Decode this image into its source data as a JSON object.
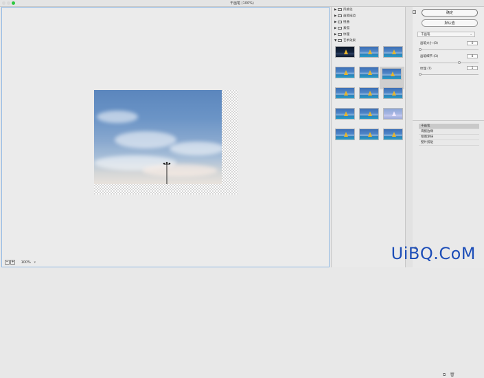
{
  "window": {
    "title": "干画笔 (100%)",
    "traffic_colors": [
      "#d9d9d9",
      "#d9d9d9",
      "#2cc840"
    ]
  },
  "preview": {
    "zoom_out_label": "−",
    "zoom_in_label": "+",
    "zoom_value": "100%",
    "zoom_dropdown_icon": "chevron-down-icon"
  },
  "gallery": {
    "folders": [
      {
        "label": "风格化",
        "expanded": false
      },
      {
        "label": "画笔描边",
        "expanded": false
      },
      {
        "label": "扭曲",
        "expanded": false
      },
      {
        "label": "素描",
        "expanded": false
      },
      {
        "label": "纹理",
        "expanded": false
      },
      {
        "label": "艺术效果",
        "expanded": true
      }
    ],
    "thumb_rows": 5,
    "thumb_cols": 3,
    "selected_thumb": 5
  },
  "settings": {
    "ok_label": "确定",
    "default_label": "默认值",
    "collapse_icon": "collapse-icon",
    "filter_select": "干画笔",
    "params": [
      {
        "label": "画笔大小 (B)",
        "value": "0",
        "fraction": 0.0
      },
      {
        "label": "画笔细节 (D)",
        "value": "8",
        "fraction": 0.8
      },
      {
        "label": "纹理 (T)",
        "value": "1",
        "fraction": 0.0
      }
    ]
  },
  "layers": {
    "items": [
      "干画笔",
      "海报边缘",
      "绘图涂抹",
      "壁片剪贴"
    ],
    "active": 0,
    "new_layer_icon": "new-layer-icon",
    "delete_icon": "trash-icon"
  },
  "watermark": "UiBQ.CoM"
}
